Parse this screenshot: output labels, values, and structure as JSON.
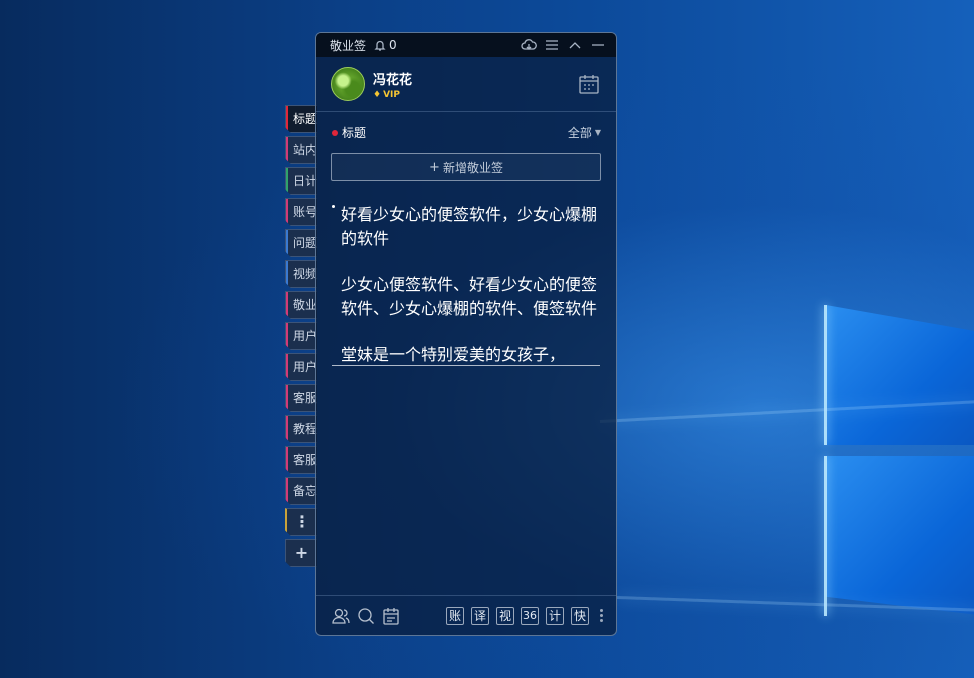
{
  "app": {
    "title": "敬业签",
    "notification_count": "0"
  },
  "user": {
    "name": "冯花花",
    "badge": "VIP"
  },
  "section": {
    "title": "标题",
    "filter": "全部"
  },
  "add_button": "新增敬业签",
  "note": {
    "paragraphs": [
      "好看少女心的便签软件，少女心爆棚的软件",
      "少女心便签软件、好看少女心的便签软件、少女心爆棚的软件、便签软件",
      "堂妹是一个特别爱美的女孩子，"
    ]
  },
  "side_tabs": [
    {
      "label": "标题",
      "color": "#e0263a",
      "active": true
    },
    {
      "label": "站内",
      "color": "#d23a78"
    },
    {
      "label": "日计",
      "color": "#2fa36b"
    },
    {
      "label": "账号",
      "color": "#d23a78"
    },
    {
      "label": "问题",
      "color": "#3a7ad2"
    },
    {
      "label": "视频",
      "color": "#3a7ad2"
    },
    {
      "label": "敬业",
      "color": "#d23a78"
    },
    {
      "label": "用户",
      "color": "#d23a78"
    },
    {
      "label": "用户",
      "color": "#d23a78"
    },
    {
      "label": "客服",
      "color": "#d23a78"
    },
    {
      "label": "教程",
      "color": "#d23a78"
    },
    {
      "label": "客服",
      "color": "#d23a78"
    },
    {
      "label": "备忘",
      "color": "#d23a78"
    }
  ],
  "side_more": "⋮",
  "side_add": "+",
  "footer_buttons": [
    "账",
    "译",
    "视",
    "36",
    "计",
    "快"
  ],
  "icons": {
    "bell": "bell-icon",
    "cloud": "cloud-sync-icon",
    "menu": "menu-icon",
    "collapse": "chevron-up-icon",
    "minimize": "minimize-icon",
    "calendar": "calendar-icon",
    "contacts": "contacts-icon",
    "search": "search-icon",
    "notes": "notes-icon"
  }
}
